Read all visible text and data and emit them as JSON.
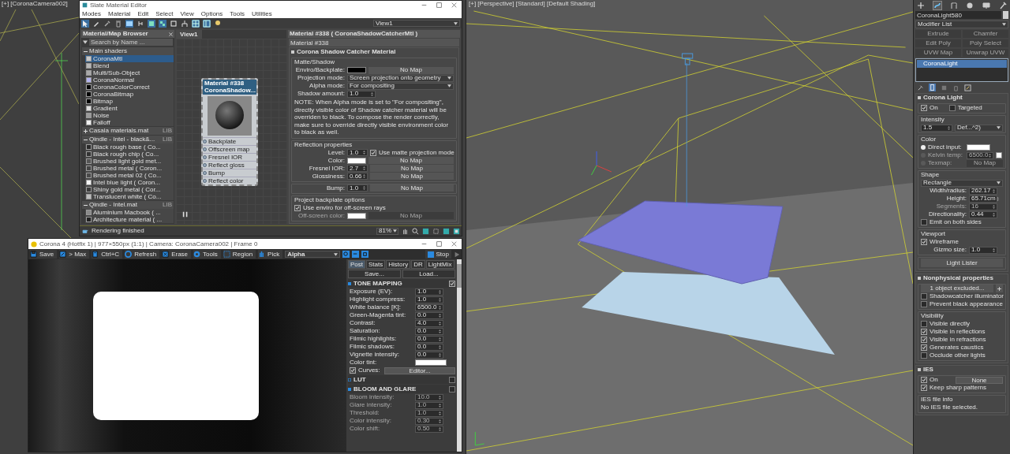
{
  "left_viewport": {
    "label": "[+] [CoronaCamera002]"
  },
  "slate": {
    "title": "Slate Material Editor",
    "menu": [
      "Modes",
      "Material",
      "Edit",
      "Select",
      "View",
      "Options",
      "Tools",
      "Utilities"
    ],
    "toolbar": [
      {
        "kind": "select",
        "on": true
      },
      {
        "kind": "pencil",
        "on": false
      },
      {
        "kind": "pick",
        "on": false
      },
      {
        "kind": "delete",
        "on": false
      },
      {
        "kind": "layout",
        "on": true
      },
      {
        "kind": "children",
        "on": false
      },
      {
        "kind": "move",
        "on": true
      },
      {
        "kind": "show",
        "on": true
      },
      {
        "kind": "arrange",
        "on": false
      },
      {
        "kind": "tree",
        "on": false
      },
      {
        "kind": "grid",
        "on": true
      },
      {
        "kind": "panel",
        "on": true
      },
      {
        "kind": "bulb",
        "on": false
      }
    ],
    "view_dropdown": "View1",
    "browser": {
      "title": "Material/Map Browser",
      "search_placeholder": "Search by Name ...",
      "groups": [
        {
          "name": "Main shaders",
          "expanded": true,
          "items": [
            {
              "label": "CoronaMtl",
              "color": "#c8c8c8",
              "selected": true
            },
            {
              "label": "Blend",
              "color": "#b8b8b8",
              "selected": false
            },
            {
              "label": "Multi/Sub-Object",
              "color": "#a8a8a8",
              "selected": false
            },
            {
              "label": "CoronaNormal",
              "color": "#b4b4f0",
              "selected": false
            },
            {
              "label": "CoronaColorCorrect",
              "color": "#000000",
              "selected": false
            },
            {
              "label": "CoronaBitmap",
              "color": "#000000",
              "selected": false
            },
            {
              "label": "Bitmap",
              "color": "#000000",
              "selected": false
            },
            {
              "label": "Gradient",
              "color": "#e0e0e0",
              "selected": false
            },
            {
              "label": "Noise",
              "color": "#9a9a9a",
              "selected": false
            },
            {
              "label": "Falloff",
              "color": "#f0f0f0",
              "selected": false
            }
          ]
        },
        {
          "name": "Casala materials.mat",
          "expanded": false,
          "badge": "LIB"
        },
        {
          "name": "Qindle - Intel - black&...",
          "expanded": true,
          "badge": "LIB",
          "items": [
            {
              "label": "Black rough base ( Co...",
              "color": "#2a2a2a",
              "selected": false
            },
            {
              "label": "Black rough chip ( Co...",
              "color": "#333333",
              "selected": false
            },
            {
              "label": "Brushed light gold met...",
              "color": "#555555",
              "selected": false
            },
            {
              "label": "Brushed metal ( Coron...",
              "color": "#444444",
              "selected": false
            },
            {
              "label": "Brushed metal 02 ( Co...",
              "color": "#4a4a4a",
              "selected": false
            },
            {
              "label": "Intel blue light ( Coron...",
              "color": "#f4f4f4",
              "selected": false
            },
            {
              "label": "Shiny gold metal ( Cor...",
              "color": "#3a3a3a",
              "selected": false
            },
            {
              "label": "Translucent white ( Co...",
              "color": "#bdbdbd",
              "selected": false
            }
          ]
        },
        {
          "name": "Qindle - Intel.mat",
          "expanded": true,
          "badge": "LIB",
          "items": [
            {
              "label": "Aluminium Macbook ( ...",
              "color": "#8a8a8a",
              "selected": false
            },
            {
              "label": "Architecture material ( ...",
              "color": "#222222",
              "selected": false
            }
          ]
        }
      ]
    },
    "view": {
      "tab": "View1",
      "node": {
        "title": "Material #338",
        "subtitle": "CoronaShadow...",
        "slots": [
          "Backplate",
          "Offscreen map",
          "Fresnel IOR",
          "Reflect gloss",
          "Bump",
          "Reflect color"
        ]
      }
    },
    "params": {
      "header": "Material #338  ( CoronaShadowCatcherMtl )",
      "name": "Material #338",
      "rollout": "Corona Shadow Catcher Material",
      "groups": [
        {
          "title": "Matte/Shadow",
          "rows": [
            {
              "kind": "swatch_map",
              "label": "Enviro/Backplate:",
              "color": "#000000",
              "map": "No Map"
            },
            {
              "kind": "dropdown",
              "label": "Projection mode:",
              "value": "Screen projection onto geometry"
            },
            {
              "kind": "dropdown",
              "label": "Alpha mode:",
              "value": "For compositing"
            },
            {
              "kind": "spinner",
              "label": "Shadow amount:",
              "value": "1.0"
            },
            {
              "kind": "note",
              "text": "NOTE: When Alpha mode is set to \"For compositing\", directly visible color of Shadow catcher material will be overriden to black. To compose the render correctly, make sure to override directly visible environment color to black as well."
            }
          ]
        },
        {
          "title": "Reflection properties",
          "rows": [
            {
              "kind": "spinner_check",
              "label": "Level:",
              "value": "1.0",
              "check": "Use matte projection mode",
              "checked": true
            },
            {
              "kind": "swatch_map",
              "label": "Color:",
              "color": "#ffffff",
              "map": "No Map"
            },
            {
              "kind": "spinner_map",
              "label": "Fresnel IOR:",
              "value": "2.7",
              "map": "No Map"
            },
            {
              "kind": "spinner_map",
              "label": "Glossiness:",
              "value": "0.66",
              "map": "No Map"
            }
          ]
        },
        {
          "rows": [
            {
              "kind": "spinner_map",
              "label": "Bump:",
              "value": "1.0",
              "map": "No Map"
            }
          ]
        },
        {
          "title": "Project backplate options",
          "rows": [
            {
              "kind": "check",
              "label": "Use enviro for off-screen rays",
              "checked": true
            },
            {
              "kind": "swatch_map",
              "label": "Off-screen color:",
              "color": "#ffffff",
              "map": "No Map",
              "disabled": true
            }
          ]
        }
      ]
    },
    "status": "Rendering finished",
    "zoom": "81%"
  },
  "vfb": {
    "title": "Corona 4 (Hotfix 1) | 977×550px (1:1) | Camera: CoronaCamera002 | Frame 0",
    "toolbar": [
      {
        "kind": "save",
        "label": "Save"
      },
      {
        "kind": "max",
        "label": "> Max"
      },
      {
        "kind": "copy",
        "label": "Ctrl+C"
      },
      {
        "kind": "refresh",
        "label": "Refresh"
      },
      {
        "kind": "erase",
        "label": "Erase"
      },
      {
        "kind": "tools",
        "label": "Tools"
      },
      {
        "kind": "region",
        "label": "Region"
      },
      {
        "kind": "pick",
        "label": "Pick"
      }
    ],
    "channel": "Alpha",
    "stop": "Stop",
    "tabs": [
      {
        "label": "Post",
        "selected": true
      },
      {
        "label": "Stats",
        "selected": false
      },
      {
        "label": "History",
        "selected": false
      },
      {
        "label": "DR",
        "selected": false
      },
      {
        "label": "LightMix",
        "selected": false
      }
    ],
    "buttons": [
      "Save...",
      "Load..."
    ],
    "sections": [
      {
        "title": "TONE MAPPING",
        "enabled": true,
        "expanded": true,
        "rows": [
          {
            "kind": "spinner",
            "label": "Exposure (EV):",
            "value": "1.0"
          },
          {
            "kind": "spinner",
            "label": "Highlight compress:",
            "value": "1.0"
          },
          {
            "kind": "spinner",
            "label": "White balance [K]:",
            "value": "6500.0"
          },
          {
            "kind": "spinner",
            "label": "Green-Magenta tint:",
            "value": "0.0"
          },
          {
            "kind": "spinner",
            "label": "Contrast:",
            "value": "4.0"
          },
          {
            "kind": "spinner",
            "label": "Saturation:",
            "value": "0.0"
          },
          {
            "kind": "spinner",
            "label": "Filmic highlights:",
            "value": "0.0"
          },
          {
            "kind": "spinner",
            "label": "Filmic shadows:",
            "value": "0.0"
          },
          {
            "kind": "spinner",
            "label": "Vignette intensity:",
            "value": "0.0"
          },
          {
            "kind": "swatch",
            "label": "Color tint:",
            "color": "#ffffff"
          },
          {
            "kind": "check_button",
            "label": "Curves:",
            "checked": true,
            "button": "Editor..."
          }
        ]
      },
      {
        "title": "LUT",
        "enabled": false,
        "expanded": false
      },
      {
        "title": "BLOOM AND GLARE",
        "enabled": false,
        "expanded": true,
        "rows": [
          {
            "kind": "spinner",
            "label": "Bloom intensity:",
            "value": "10.0",
            "disabled": true
          },
          {
            "kind": "spinner",
            "label": "Glare intensity:",
            "value": "1.0",
            "disabled": true
          },
          {
            "kind": "spinner",
            "label": "Threshold:",
            "value": "1.0",
            "disabled": true
          },
          {
            "kind": "spinner",
            "label": "Color intensity:",
            "value": "0.30",
            "disabled": true
          },
          {
            "kind": "spinner",
            "label": "Color shift:",
            "value": "0.50",
            "disabled": true
          }
        ]
      }
    ]
  },
  "viewport": {
    "label": "[+] [Perspective] [Standard] [Default Shading]"
  },
  "command_panel": {
    "tabs": [
      {
        "kind": "create",
        "selected": false
      },
      {
        "kind": "modify",
        "selected": true
      },
      {
        "kind": "hierarchy",
        "selected": false
      },
      {
        "kind": "motion",
        "selected": false
      },
      {
        "kind": "display",
        "selected": false
      },
      {
        "kind": "utilities",
        "selected": false
      }
    ],
    "object": {
      "name": "CoronaLight580",
      "color": "#d0d0d0"
    },
    "modifier_list": "Modifier List",
    "modifier_buttons": [
      {
        "label": "Extrude",
        "disabled": true
      },
      {
        "label": "Chamfer",
        "disabled": true
      },
      {
        "label": "Edit Poly",
        "disabled": true
      },
      {
        "label": "Poly Select",
        "disabled": true
      },
      {
        "label": "UVW Map",
        "disabled": true
      },
      {
        "label": "Unwrap UVW",
        "disabled": true
      }
    ],
    "stack": [
      {
        "label": "CoronaLight",
        "selected": true
      }
    ],
    "rollouts": [
      {
        "title": "Corona Light",
        "expanded": true,
        "groups": [
          {
            "rows": [
              {
                "kind": "checks_pair",
                "items": [
                  {
                    "label": "On",
                    "checked": true
                  },
                  {
                    "label": "Targeted",
                    "checked": false
                  }
                ]
              }
            ]
          },
          {
            "title": "Intensity",
            "rows": [
              {
                "kind": "spinner_dropdown",
                "value": "1.5",
                "option": "Def...^2)"
              }
            ]
          },
          {
            "title": "Color",
            "rows": [
              {
                "kind": "radio",
                "label": "Direct input:",
                "selected": true,
                "color": "#ffffff"
              },
              {
                "kind": "radio",
                "label": "Kelvin temp:",
                "selected": false,
                "value": "6500.0",
                "color": "#ffffff",
                "disabled": true
              },
              {
                "kind": "radio",
                "label": "Texmap:",
                "selected": false,
                "map": "No Map",
                "disabled": true
              }
            ]
          },
          {
            "title": "Shape",
            "rows": [
              {
                "kind": "dropdown",
                "value": "Rectangle"
              },
              {
                "kind": "spinner",
                "label": "Width/radius:",
                "value": "262.17"
              },
              {
                "kind": "spinner",
                "label": "Height:",
                "value": "65.71cm"
              },
              {
                "kind": "spinner",
                "label": "Segments:",
                "value": "16",
                "disabled": true
              },
              {
                "kind": "spinner",
                "label": "Directionality:",
                "value": "0.44"
              },
              {
                "kind": "check",
                "label": "Emit on both sides",
                "checked": false
              }
            ]
          },
          {
            "title": "Viewport",
            "rows": [
              {
                "kind": "check",
                "label": "Wireframe",
                "checked": true
              },
              {
                "kind": "spinner",
                "label": "Gizmo size:",
                "value": "1.0"
              }
            ]
          },
          {
            "rows": [
              {
                "kind": "button",
                "label": "Light Lister"
              }
            ]
          }
        ]
      },
      {
        "title": "Nonphysical properties",
        "expanded": true,
        "groups": [
          {
            "rows": [
              {
                "kind": "button_plus",
                "label": "1 object excluded..."
              },
              {
                "kind": "check",
                "label": "Shadowcatcher illuminator",
                "checked": false
              },
              {
                "kind": "check",
                "label": "Prevent black appearance",
                "checked": false
              }
            ]
          },
          {
            "title": "Visibility",
            "rows": [
              {
                "kind": "check",
                "label": "Visible directly",
                "checked": false
              },
              {
                "kind": "check",
                "label": "Visible in reflections",
                "checked": true
              },
              {
                "kind": "check",
                "label": "Visible in refractions",
                "checked": true
              },
              {
                "kind": "check",
                "label": "Generates caustics",
                "checked": true
              },
              {
                "kind": "check",
                "label": "Occlude other lights",
                "checked": false
              }
            ]
          }
        ]
      },
      {
        "title": "IES",
        "expanded": true,
        "groups": [
          {
            "rows": [
              {
                "kind": "check_button",
                "label": "On",
                "checked": true,
                "button": "None"
              },
              {
                "kind": "check",
                "label": "Keep sharp patterns",
                "checked": true
              }
            ]
          },
          {
            "title": "IES file info",
            "rows": [
              {
                "kind": "text",
                "text": "No IES file selected."
              }
            ]
          }
        ]
      }
    ]
  }
}
